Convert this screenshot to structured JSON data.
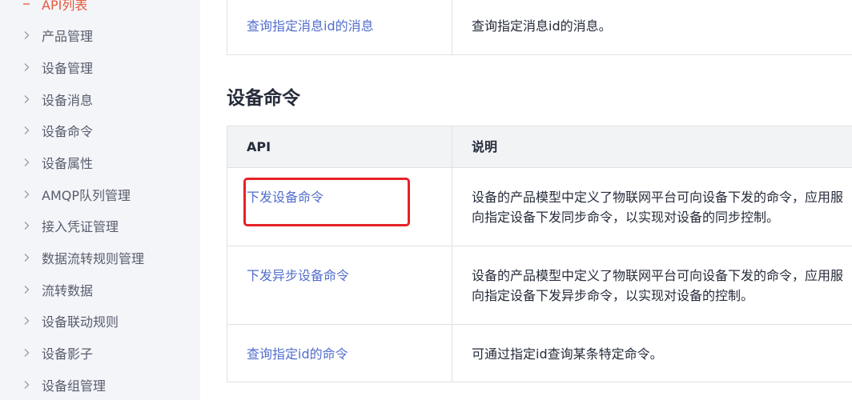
{
  "sidebar": {
    "active_item": {
      "label": "API列表",
      "icon": "minus-icon"
    },
    "items": [
      {
        "label": "产品管理",
        "icon": "chevron-right-icon"
      },
      {
        "label": "设备管理",
        "icon": "chevron-right-icon"
      },
      {
        "label": "设备消息",
        "icon": "chevron-right-icon"
      },
      {
        "label": "设备命令",
        "icon": "chevron-right-icon"
      },
      {
        "label": "设备属性",
        "icon": "chevron-right-icon"
      },
      {
        "label": "AMQP队列管理",
        "icon": "chevron-right-icon"
      },
      {
        "label": "接入凭证管理",
        "icon": "chevron-right-icon"
      },
      {
        "label": "数据流转规则管理",
        "icon": "chevron-right-icon"
      },
      {
        "label": "流转数据",
        "icon": "chevron-right-icon"
      },
      {
        "label": "设备联动规则",
        "icon": "chevron-right-icon"
      },
      {
        "label": "设备影子",
        "icon": "chevron-right-icon"
      },
      {
        "label": "设备组管理",
        "icon": "chevron-right-icon"
      }
    ]
  },
  "top_table": {
    "rows": [
      {
        "api": "查询指定消息id的消息",
        "description_lines": [
          "查询指定消息id的消息。"
        ]
      }
    ]
  },
  "device_commands": {
    "heading": "设备命令",
    "table": {
      "headers": {
        "api": "API",
        "description": "说明"
      },
      "rows": [
        {
          "api": "下发设备命令",
          "highlighted": true,
          "description_lines": [
            "设备的产品模型中定义了物联网平台可向设备下发的命令，应用服",
            "向指定设备下发同步命令，以实现对设备的同步控制。"
          ]
        },
        {
          "api": "下发异步设备命令",
          "highlighted": false,
          "description_lines": [
            "设备的产品模型中定义了物联网平台可向设备下发的命令，应用服",
            "向指定设备下发异步命令，以实现对设备的控制。"
          ]
        },
        {
          "api": "查询指定id的命令",
          "highlighted": false,
          "description_lines": [
            "可通过指定id查询某条特定命令。"
          ]
        }
      ]
    }
  },
  "colors": {
    "sidebar_bg": "#f4f5f9",
    "sidebar_text": "#575d6c",
    "active_item": "#e65a3c",
    "chevron": "#8a8e99",
    "link": "#526ecc",
    "text": "#252b3a",
    "table_border": "#dfe1e6",
    "table_header_bg": "#f2f3f5",
    "annotation": "#e62129"
  }
}
